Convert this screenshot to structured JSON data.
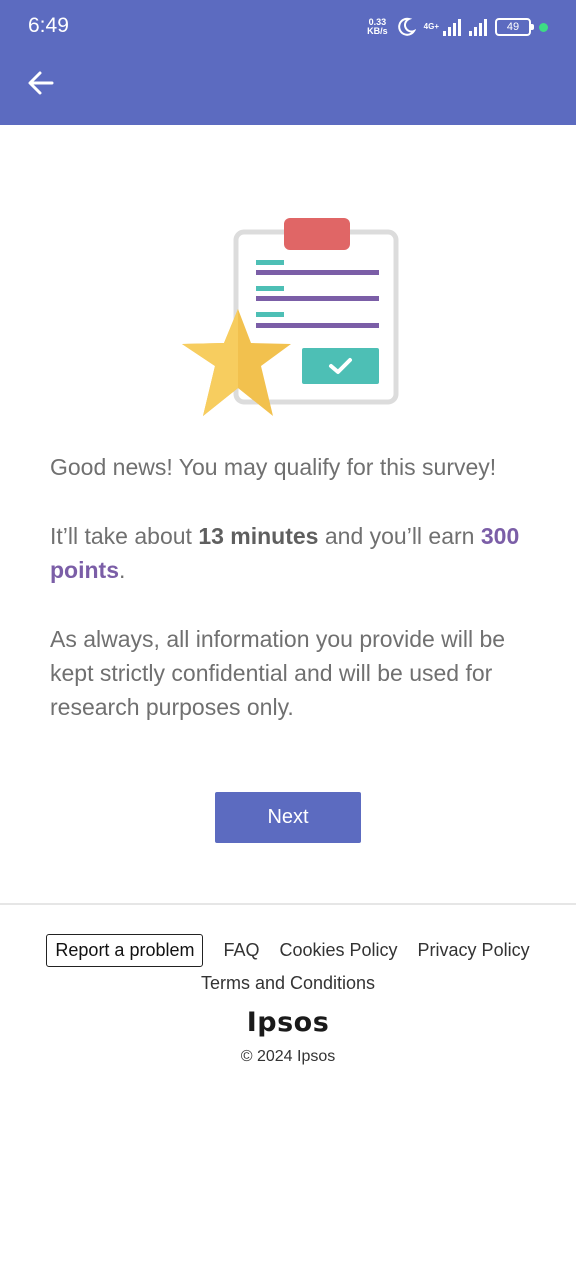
{
  "status_bar": {
    "time": "6:49",
    "net_speed_value": "0.33",
    "net_speed_unit": "KB/s",
    "network_label": "4G+",
    "battery": "49"
  },
  "illustration": {
    "icon": "clipboard-star-illustration",
    "colors": {
      "clip": "#e06666",
      "teal": "#4dbfb5",
      "purple": "#7b5ea7",
      "star": "#f2c14e"
    }
  },
  "content": {
    "headline": "Good news! You may qualify for this survey!",
    "duration_prefix": "It’ll take about ",
    "duration_value": "13 minutes",
    "duration_middle": " and you’ll earn ",
    "points_value": "300 points",
    "points_suffix": ".",
    "confidential": "As always, all information you provide will be kept strictly confidential and will be used for research purposes only."
  },
  "next_label": "Next",
  "footer": {
    "report_label": "Report a problem",
    "faq_label": "FAQ",
    "cookies_label": "Cookies Policy",
    "privacy_label": "Privacy Policy",
    "terms_label": "Terms and Conditions",
    "logo_text": "Ipsos",
    "copyright": "© 2024 Ipsos"
  },
  "colors": {
    "accent": "#5c6bc0",
    "points": "#7b5ea7"
  }
}
